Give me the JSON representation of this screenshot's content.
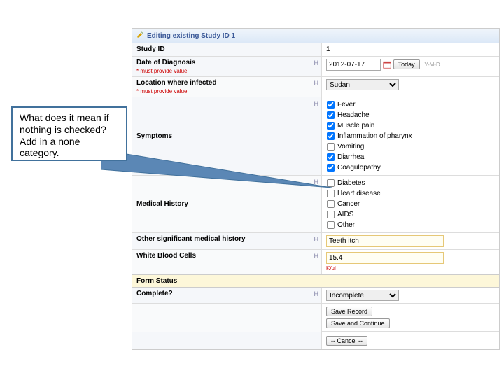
{
  "header": {
    "title": "Editing existing Study ID 1"
  },
  "fields": {
    "study_id": {
      "label": "Study ID",
      "value": "1"
    },
    "date_of_diagnosis": {
      "label": "Date of Diagnosis",
      "required_text": "* must provide value",
      "value": "2012-07-17",
      "today_btn": "Today",
      "hint": "Y-M-D"
    },
    "location": {
      "label": "Location where infected",
      "required_text": "* must provide value",
      "value": "Sudan"
    },
    "symptoms": {
      "label": "Symptoms",
      "items": [
        {
          "label": "Fever",
          "checked": true
        },
        {
          "label": "Headache",
          "checked": true
        },
        {
          "label": "Muscle pain",
          "checked": true
        },
        {
          "label": "Inflammation of pharynx",
          "checked": true
        },
        {
          "label": "Vomiting",
          "checked": false
        },
        {
          "label": "Diarrhea",
          "checked": true
        },
        {
          "label": "Coagulopathy",
          "checked": true
        }
      ]
    },
    "medical_history": {
      "label": "Medical History",
      "items": [
        {
          "label": "Diabetes",
          "checked": false
        },
        {
          "label": "Heart disease",
          "checked": false
        },
        {
          "label": "Cancer",
          "checked": false
        },
        {
          "label": "AIDS",
          "checked": false
        },
        {
          "label": "Other",
          "checked": false
        }
      ]
    },
    "other_history": {
      "label": "Other significant medical history",
      "value": "Teeth itch"
    },
    "wbc": {
      "label": "White Blood Cells",
      "value": "15.4",
      "unit": "K/ul"
    }
  },
  "form_status": {
    "section": "Form Status",
    "complete_label": "Complete?",
    "complete_value": "Incomplete",
    "save_record": "Save Record",
    "save_continue": "Save and Continue",
    "cancel": "-- Cancel --"
  },
  "callout": "What does it mean if nothing is checked?  Add in a none category."
}
